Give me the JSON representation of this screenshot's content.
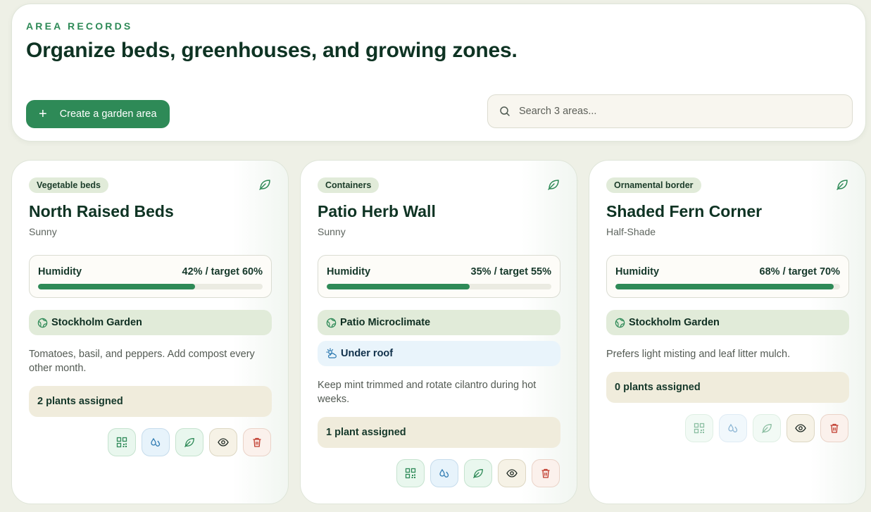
{
  "header": {
    "eyebrow": "AREA RECORDS",
    "title": "Organize beds, greenhouses, and growing zones.",
    "create_label": "Create a garden area",
    "search_placeholder": "Search 3 areas..."
  },
  "colors": {
    "accent": "#2e8a57",
    "title": "#0e3323",
    "badge_bg": "#e1ebd9",
    "assigned_bg": "#f0ecdc",
    "roof_bg": "#e9f4fb",
    "danger": "#c0392b"
  },
  "areas": [
    {
      "badge": "Vegetable beds",
      "name": "North Raised Beds",
      "light": "Sunny",
      "humidity_label": "Humidity",
      "humidity_text": "42% / target 60%",
      "humidity_current": 42,
      "humidity_target": 60,
      "garden": "Stockholm Garden",
      "note": "Tomatoes, basil, and peppers. Add compost every other month.",
      "assigned": "2 plants assigned",
      "icon": "leaf-icon"
    },
    {
      "badge": "Containers",
      "name": "Patio Herb Wall",
      "light": "Sunny",
      "humidity_label": "Humidity",
      "humidity_text": "35% / target 55%",
      "humidity_current": 35,
      "humidity_target": 55,
      "garden": "Patio Microclimate",
      "shelter": "Under roof",
      "note": "Keep mint trimmed and rotate cilantro during hot weeks.",
      "assigned": "1 plant assigned",
      "icon": "leaf-icon"
    },
    {
      "badge": "Ornamental border",
      "name": "Shaded Fern Corner",
      "light": "Half-Shade",
      "humidity_label": "Humidity",
      "humidity_text": "68% / target 70%",
      "humidity_current": 68,
      "humidity_target": 70,
      "garden": "Stockholm Garden",
      "note": "Prefers light misting and leaf litter mulch.",
      "assigned": "0 plants assigned",
      "icon": "leaf-icon"
    }
  ]
}
